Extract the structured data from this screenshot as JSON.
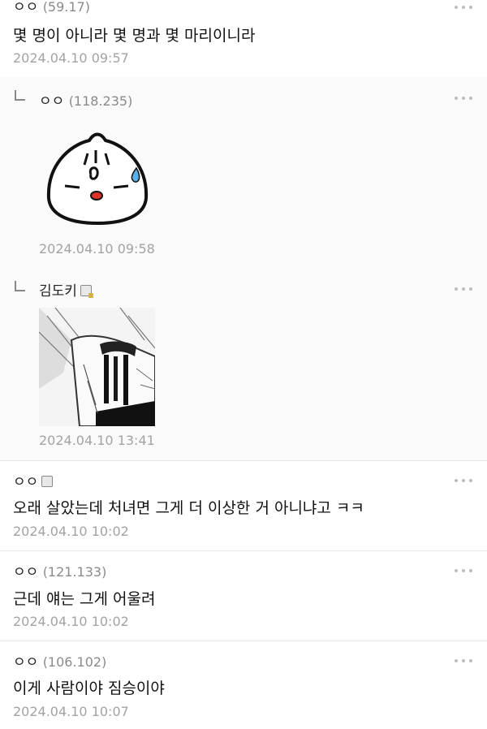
{
  "comments": [
    {
      "author": "ㅇㅇ",
      "ip": "(59.17)",
      "text": "몇 명이 아니라 몇 명과 몇 마리이니라",
      "date": "2024.04.10 09:57"
    },
    {
      "author": "ㅇㅇ",
      "ip": "(118.235)",
      "date": "2024.04.10 09:58",
      "image": "dumpling-sweat-emoticon"
    },
    {
      "author": "김도키",
      "date": "2024.04.10 13:41",
      "image": "manga-crying-panel"
    },
    {
      "author": "ㅇㅇ",
      "text": "오래 살았는데 처녀면 그게 더 이상한 거 아니냐고 ㅋㅋ",
      "date": "2024.04.10 10:02"
    },
    {
      "author": "ㅇㅇ",
      "ip": "(121.133)",
      "text": "근데 얘는 그게 어울려",
      "date": "2024.04.10 10:02"
    },
    {
      "author": "ㅇㅇ",
      "ip": "(106.102)",
      "text": "이게 사람이야 짐승이야",
      "date": "2024.04.10 10:07"
    }
  ],
  "icons": {
    "more": "more-dots-icon",
    "reply": "reply-arrow-icon",
    "member": "member-badge-icon"
  }
}
